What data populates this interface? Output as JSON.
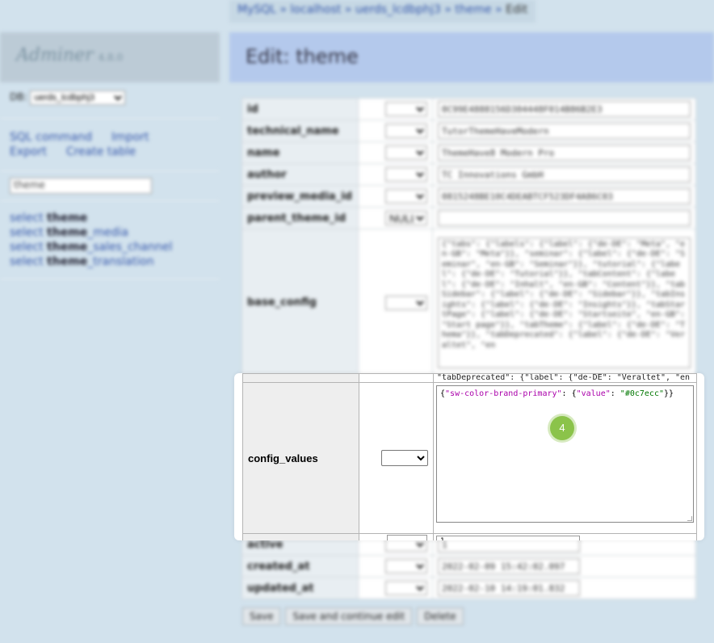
{
  "breadcrumb": {
    "items": [
      "MySQL",
      "localhost",
      "uerds_lcdbphj3",
      "theme"
    ],
    "current": "Edit"
  },
  "sidebar": {
    "app_name": "Adminer",
    "version": "4.8.0",
    "db_label": "DB:",
    "db_value": "uerds_lcdbphj3",
    "links": [
      "SQL command",
      "Import",
      "Export",
      "Create table"
    ],
    "filter_value": "theme",
    "tables": [
      {
        "prefix": "select ",
        "bold": "theme",
        "suffix": ""
      },
      {
        "prefix": "select ",
        "bold": "theme",
        "suffix": "_media"
      },
      {
        "prefix": "select ",
        "bold": "theme",
        "suffix": "_sales_channel"
      },
      {
        "prefix": "select ",
        "bold": "theme",
        "suffix": "_translation"
      }
    ]
  },
  "page_title": "Edit: theme",
  "fields": [
    {
      "name": "id",
      "value": "0C99E4888156D304448F014B86B2E3"
    },
    {
      "name": "technical_name",
      "value": "TutorThemeHaveModern"
    },
    {
      "name": "name",
      "value": "ThemeHave8 Modern Pro"
    },
    {
      "name": "author",
      "value": "TC Innovations GmbH"
    },
    {
      "name": "preview_media_id",
      "value": "0815248BE10C4DEABTCF523DF4A86C03"
    },
    {
      "name": "parent_theme_id",
      "function": "NULL",
      "value": ""
    },
    {
      "name": "base_config",
      "value": "{\"tabs\": {\"labels\": {\"label\": {\"de-DE\": \"Meta\", \"en-GB\": \"Meta\"}}, \"seminar\": {\"label\": {\"de-DE\": \"Seminar\", \"en-GB\": \"Seminar\"}}, \"tutorial\": {\"label\": {\"de-DE\": \"Tutorial\"}}, \"tabContent\": {\"label\": {\"de-DE\": \"Inhalt\", \"en-GB\": \"Content\"}}, \"tabSidebar\": {\"label\": {\"de-DE\": \"Sidebar\"}}, \"tabInsights\": {\"label\": {\"de-DE\": \"Insights\"}}, \"tabStartPage\": {\"label\": {\"de-DE\": \"Startseite\", \"en-GB\": \"Start page\"}}, \"tabTheme\": {\"label\": {\"de-DE\": \"Thema\"}}, \"tabDeprecated\": {\"label\": {\"de-DE\": \"Veraltet\", \"en"
    },
    {
      "name": "config_values",
      "value_key": "sw-color-brand-primary",
      "value_subkey": "value",
      "value_color": "#0c7ecc"
    },
    {
      "name": "active",
      "value": "1"
    },
    {
      "name": "created_at",
      "value": "2022-02-09 15:42:02.097"
    },
    {
      "name": "updated_at",
      "value": "2022-02-10 14:19:01.832"
    }
  ],
  "focus": {
    "top_line": "\"tabDeprecated\": {\"label\": {\"de-DE\": \"Veraltet\", \"en",
    "field_label": "config_values",
    "json_prefix": "{",
    "json_key": "\"sw-color-brand-primary\"",
    "json_mid": ": {",
    "json_subkey": "\"value\"",
    "json_colon": ": ",
    "json_value": "\"#0c7ecc\"",
    "json_suffix": "}}",
    "bottom_value": "1"
  },
  "buttons": [
    "Save",
    "Save and continue edit",
    "Delete"
  ],
  "step_badge": "4"
}
